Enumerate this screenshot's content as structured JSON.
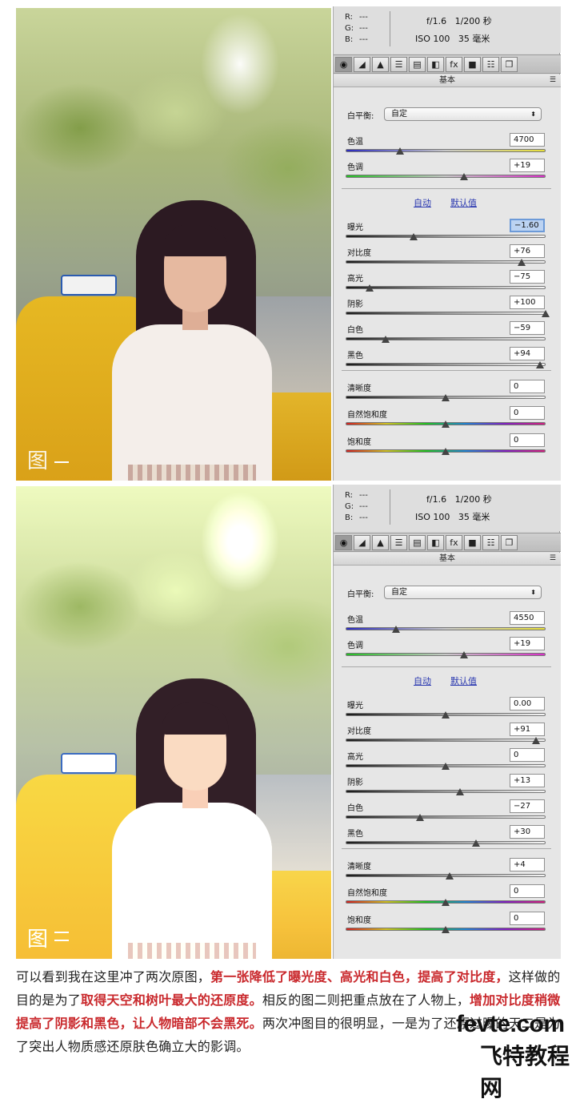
{
  "panels": [
    {
      "badge": "图",
      "info": {
        "r_label": "R:",
        "r": "---",
        "g_label": "G:",
        "g": "---",
        "b_label": "B:",
        "b": "---",
        "aperture": "f/1.6",
        "shutter": "1/200 秒",
        "iso": "ISO 100",
        "focal": "35 毫米"
      },
      "section_title": "基本",
      "white_balance": {
        "label": "白平衡:",
        "value": "自定"
      },
      "auto_link": "自动",
      "default_link": "默认值",
      "rows": [
        {
          "label": "色温",
          "value": "4700",
          "pos": 0.27,
          "track": "temp"
        },
        {
          "label": "色调",
          "value": "+19",
          "pos": 0.59,
          "track": "tint"
        },
        {
          "label": "曝光",
          "value": "−1.60",
          "pos": 0.34,
          "track": "gray",
          "selected": true
        },
        {
          "label": "对比度",
          "value": "+76",
          "pos": 0.88,
          "track": "gray"
        },
        {
          "label": "高光",
          "value": "−75",
          "pos": 0.12,
          "track": "gray"
        },
        {
          "label": "阴影",
          "value": "+100",
          "pos": 1.0,
          "track": "gray"
        },
        {
          "label": "白色",
          "value": "−59",
          "pos": 0.2,
          "track": "gray"
        },
        {
          "label": "黑色",
          "value": "+94",
          "pos": 0.97,
          "track": "gray"
        },
        {
          "label": "清晰度",
          "value": "0",
          "pos": 0.5,
          "track": "gray"
        },
        {
          "label": "自然饱和度",
          "value": "0",
          "pos": 0.5,
          "track": "sat"
        },
        {
          "label": "饱和度",
          "value": "0",
          "pos": 0.5,
          "track": "sat"
        }
      ]
    },
    {
      "badge": "图",
      "info": {
        "r_label": "R:",
        "r": "---",
        "g_label": "G:",
        "g": "---",
        "b_label": "B:",
        "b": "---",
        "aperture": "f/1.6",
        "shutter": "1/200 秒",
        "iso": "ISO 100",
        "focal": "35 毫米"
      },
      "section_title": "基本",
      "white_balance": {
        "label": "白平衡:",
        "value": "自定"
      },
      "auto_link": "自动",
      "default_link": "默认值",
      "rows": [
        {
          "label": "色温",
          "value": "4550",
          "pos": 0.25,
          "track": "temp"
        },
        {
          "label": "色调",
          "value": "+19",
          "pos": 0.59,
          "track": "tint"
        },
        {
          "label": "曝光",
          "value": "0.00",
          "pos": 0.5,
          "track": "gray"
        },
        {
          "label": "对比度",
          "value": "+91",
          "pos": 0.95,
          "track": "gray"
        },
        {
          "label": "高光",
          "value": "0",
          "pos": 0.5,
          "track": "gray"
        },
        {
          "label": "阴影",
          "value": "+13",
          "pos": 0.57,
          "track": "gray"
        },
        {
          "label": "白色",
          "value": "−27",
          "pos": 0.37,
          "track": "gray"
        },
        {
          "label": "黑色",
          "value": "+30",
          "pos": 0.65,
          "track": "gray"
        },
        {
          "label": "清晰度",
          "value": "+4",
          "pos": 0.52,
          "track": "gray"
        },
        {
          "label": "自然饱和度",
          "value": "0",
          "pos": 0.5,
          "track": "sat"
        },
        {
          "label": "饱和度",
          "value": "0",
          "pos": 0.5,
          "track": "sat"
        }
      ]
    }
  ],
  "toolbar_icons": [
    "aperture-icon",
    "curve-icon",
    "mountain-icon",
    "hsl-icon",
    "split-icon",
    "lens-icon",
    "fx-icon",
    "camera-icon",
    "presets-icon",
    "snapshots-icon"
  ],
  "toolbar_glyphs": [
    "◉",
    "◢",
    "▲",
    "☰",
    "▤",
    "◧",
    "fx",
    "■",
    "☷",
    "❐"
  ],
  "caption": {
    "p1": "可以看到我在这里冲了两次原图，",
    "r1": "第一张降低了曝光度、高光和白色，提高了对比度，",
    "p2": "这样做的目的是为了",
    "r2": "取得天空和树叶最大的还原度。",
    "p3": "相反的图二则把重点放在了人物上，",
    "r3": "增加对比度稍微提高了阴影和黑色，让人物暗部不会黑死。",
    "p4": "两次冲图目的很明显，一是为了还原过曝的天二是为了突出人物质感还原肤色确立大的影调。"
  },
  "watermark": {
    "line1": "fevte.com",
    "line2": "飞特教程网"
  }
}
